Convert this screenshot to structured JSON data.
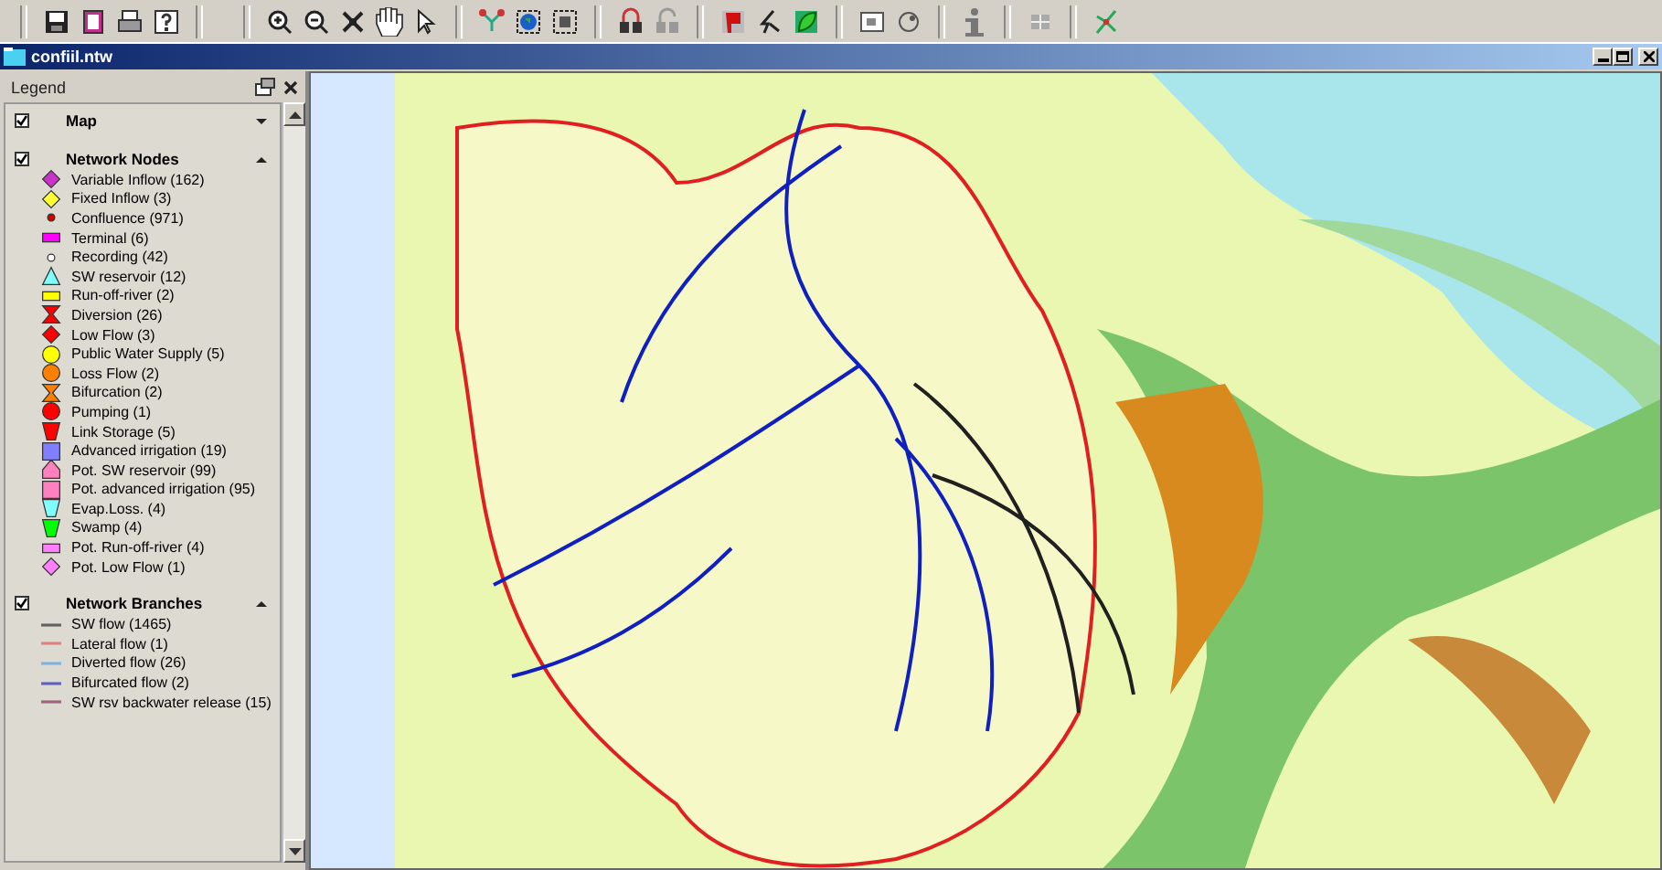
{
  "window": {
    "title": "confiil.ntw"
  },
  "legend": {
    "title": "Legend",
    "sections": [
      {
        "title": "Map",
        "checked": true,
        "expanded": false
      },
      {
        "title": "Network Nodes",
        "checked": true,
        "expanded": true,
        "items": [
          {
            "label": "Variable Inflow (162)",
            "kind": "diamond",
            "color": "#cc33cc"
          },
          {
            "label": "Fixed Inflow (3)",
            "kind": "diamond",
            "color": "#ffff33"
          },
          {
            "label": "Confluence (971)",
            "kind": "dot",
            "color": "#cc0000"
          },
          {
            "label": "Terminal (6)",
            "kind": "rect",
            "color": "#ff00ff"
          },
          {
            "label": "Recording (42)",
            "kind": "ring",
            "color": "#ffffff"
          },
          {
            "label": "SW reservoir (12)",
            "kind": "triangle",
            "color": "#80ffff"
          },
          {
            "label": "Run-off-river (2)",
            "kind": "rect",
            "color": "#ffff00"
          },
          {
            "label": "Diversion (26)",
            "kind": "hourglass",
            "color": "#ff0000"
          },
          {
            "label": "Low Flow (3)",
            "kind": "diamond",
            "color": "#ff0000"
          },
          {
            "label": "Public Water Supply (5)",
            "kind": "circle",
            "color": "#ffff00"
          },
          {
            "label": "Loss Flow (2)",
            "kind": "circle",
            "color": "#ff8000"
          },
          {
            "label": "Bifurcation (2)",
            "kind": "hourglass",
            "color": "#ff8000"
          },
          {
            "label": "Pumping (1)",
            "kind": "circle",
            "color": "#ff0000"
          },
          {
            "label": "Link Storage (5)",
            "kind": "bucket",
            "color": "#ff0000"
          },
          {
            "label": "Advanced irrigation (19)",
            "kind": "square",
            "color": "#8080ff"
          },
          {
            "label": "Pot. SW reservoir (99)",
            "kind": "house",
            "color": "#ff80c0"
          },
          {
            "label": "Pot. advanced irrigation (95)",
            "kind": "square",
            "color": "#ff80c0"
          },
          {
            "label": "Evap.Loss. (4)",
            "kind": "bucket",
            "color": "#80ffff"
          },
          {
            "label": "Swamp (4)",
            "kind": "bucket",
            "color": "#00ff00"
          },
          {
            "label": "Pot. Run-off-river (4)",
            "kind": "rect",
            "color": "#ff80ff"
          },
          {
            "label": "Pot. Low Flow (1)",
            "kind": "diamond",
            "color": "#ff80ff"
          }
        ]
      },
      {
        "title": "Network Branches",
        "checked": true,
        "expanded": true,
        "items": [
          {
            "label": "SW flow (1465)",
            "kind": "line",
            "color": "#606060"
          },
          {
            "label": "Lateral flow (1)",
            "kind": "line",
            "color": "#e08080"
          },
          {
            "label": "Diverted flow (26)",
            "kind": "line",
            "color": "#80b0e0"
          },
          {
            "label": "Bifurcated flow (2)",
            "kind": "line",
            "color": "#6060c0"
          },
          {
            "label": "SW rsv backwater release (15)",
            "kind": "line",
            "color": "#a06080"
          }
        ]
      }
    ]
  }
}
